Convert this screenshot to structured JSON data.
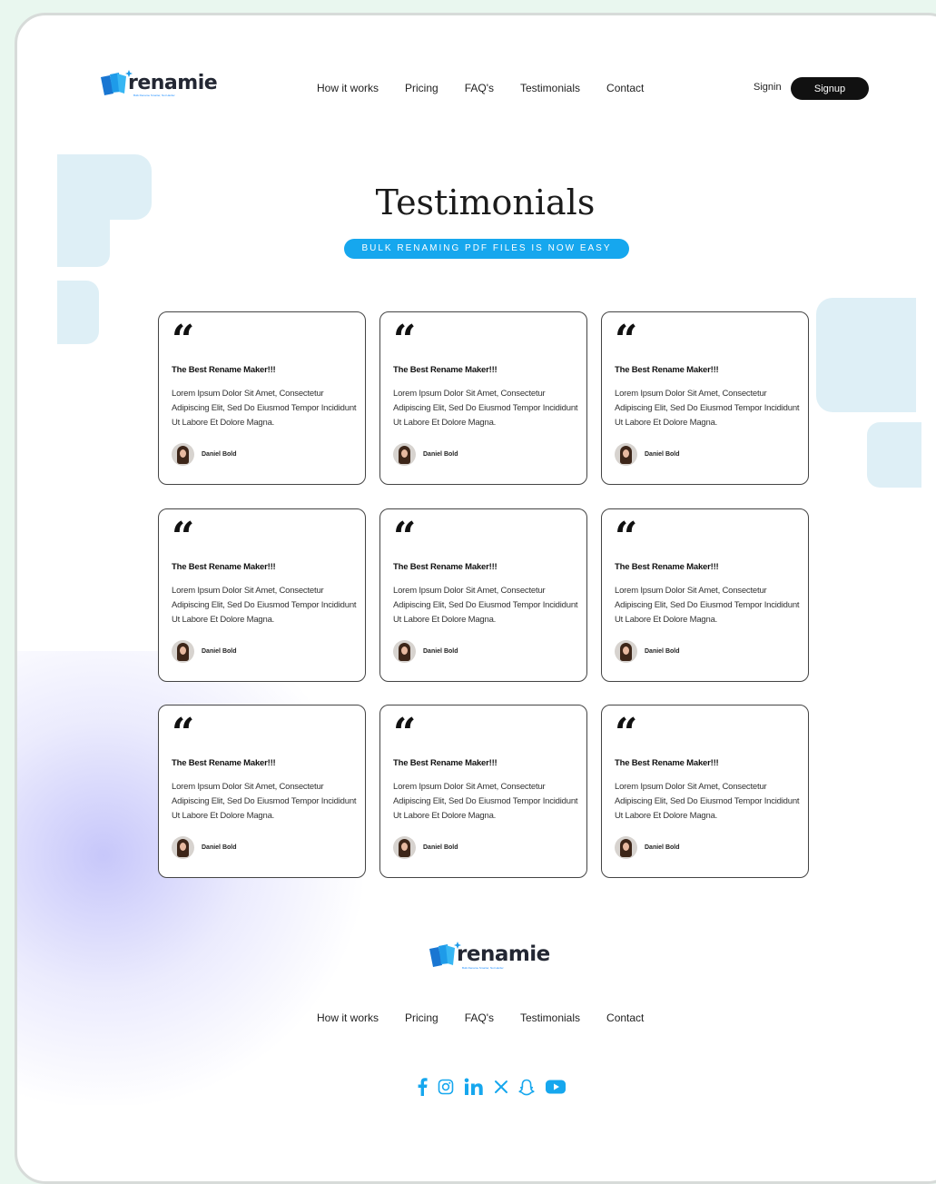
{
  "brand": {
    "name": "renamie",
    "tagline": "Bulk Rename Smarter, Not Harder",
    "colors": {
      "primary": "#16a7ee",
      "dark": "#111111",
      "card_border": "#444444"
    }
  },
  "header": {
    "nav": [
      "How it works",
      "Pricing",
      "FAQ's",
      "Testimonials",
      "Contact"
    ],
    "signin_label": "Signin",
    "signup_label": "Signup"
  },
  "hero": {
    "title": "Testimonials",
    "badge": "BULK RENAMING PDF FILES IS NOW EASY"
  },
  "testimonials": [
    {
      "quote_mark": "“",
      "title": "The Best Rename Maker!!!",
      "body": "Lorem Ipsum Dolor Sit Amet, Consectetur Adipiscing Elit, Sed Do Eiusmod Tempor Incididunt Ut Labore Et Dolore Magna.",
      "author": "Daniel Bold"
    },
    {
      "quote_mark": "“",
      "title": "The Best Rename Maker!!!",
      "body": "Lorem Ipsum Dolor Sit Amet, Consectetur Adipiscing Elit, Sed Do Eiusmod Tempor Incididunt Ut Labore Et Dolore Magna.",
      "author": "Daniel Bold"
    },
    {
      "quote_mark": "“",
      "title": "The Best Rename Maker!!!",
      "body": "Lorem Ipsum Dolor Sit Amet, Consectetur Adipiscing Elit, Sed Do Eiusmod Tempor Incididunt Ut Labore Et Dolore Magna.",
      "author": "Daniel Bold"
    },
    {
      "quote_mark": "“",
      "title": "The Best Rename Maker!!!",
      "body": "Lorem Ipsum Dolor Sit Amet, Consectetur Adipiscing Elit, Sed Do Eiusmod Tempor Incididunt Ut Labore Et Dolore Magna.",
      "author": "Daniel Bold"
    },
    {
      "quote_mark": "“",
      "title": "The Best Rename Maker!!!",
      "body": "Lorem Ipsum Dolor Sit Amet, Consectetur Adipiscing Elit, Sed Do Eiusmod Tempor Incididunt Ut Labore Et Dolore Magna.",
      "author": "Daniel Bold"
    },
    {
      "quote_mark": "“",
      "title": "The Best Rename Maker!!!",
      "body": "Lorem Ipsum Dolor Sit Amet, Consectetur Adipiscing Elit, Sed Do Eiusmod Tempor Incididunt Ut Labore Et Dolore Magna.",
      "author": "Daniel Bold"
    },
    {
      "quote_mark": "“",
      "title": "The Best Rename Maker!!!",
      "body": "Lorem Ipsum Dolor Sit Amet, Consectetur Adipiscing Elit, Sed Do Eiusmod Tempor Incididunt Ut Labore Et Dolore Magna.",
      "author": "Daniel Bold"
    },
    {
      "quote_mark": "“",
      "title": "The Best Rename Maker!!!",
      "body": "Lorem Ipsum Dolor Sit Amet, Consectetur Adipiscing Elit, Sed Do Eiusmod Tempor Incididunt Ut Labore Et Dolore Magna.",
      "author": "Daniel Bold"
    },
    {
      "quote_mark": "“",
      "title": "The Best Rename Maker!!!",
      "body": "Lorem Ipsum Dolor Sit Amet, Consectetur Adipiscing Elit, Sed Do Eiusmod Tempor Incididunt Ut Labore Et Dolore Magna.",
      "author": "Daniel Bold"
    }
  ],
  "footer": {
    "nav": [
      "How it works",
      "Pricing",
      "FAQ's",
      "Testimonials",
      "Contact"
    ],
    "social": [
      "facebook-icon",
      "instagram-icon",
      "linkedin-icon",
      "x-icon",
      "snapchat-icon",
      "youtube-icon"
    ]
  }
}
